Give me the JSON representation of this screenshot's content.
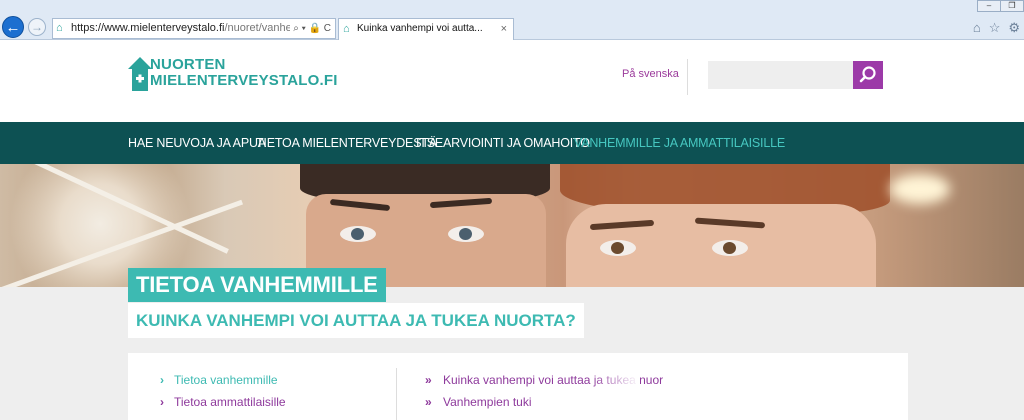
{
  "browser": {
    "url_main": "https://www.mielenterveystalo.fi",
    "url_path": "/nuoret/vanhemm",
    "tab_title": "Kuinka vanhempi voi autta...",
    "tab_close": "×",
    "back_symbol": "←",
    "forward_symbol": "→",
    "addr_tools": "⌕ ▾ 🔒 C"
  },
  "header": {
    "logo_line1": "NUORTEN",
    "logo_line2": "MIELENTERVEYSTALO.FI",
    "language_link": "På svenska",
    "search": {
      "value": "",
      "placeholder": ""
    }
  },
  "nav": {
    "items": [
      {
        "label": "HAE NEUVOJA JA APUA",
        "active": false
      },
      {
        "label": "TIETOA MIELENTERVEYDESTÄ",
        "active": false
      },
      {
        "label": "ITSEARVIOINTI JA OMAHOITO",
        "active": false
      },
      {
        "label": "VANHEMMILLE JA AMMATTILAISILLE",
        "active": true
      }
    ]
  },
  "page": {
    "title": "TIETOA VANHEMMILLE",
    "subtitle": "KUINKA VANHEMPI VOI AUTTAA JA TUKEA NUORTA?"
  },
  "left_menu": [
    {
      "chevron": "›",
      "label": "Tietoa vanhemmille",
      "color": "#3dbab2"
    },
    {
      "chevron": "›",
      "label": "Tietoa ammattilaisille",
      "color": "#8e3a9c"
    }
  ],
  "right_menu": [
    {
      "chevron": "»",
      "label": "Kuinka vanhempi voi auttaa ja tukea nuor"
    },
    {
      "chevron": "»",
      "label": "Vanhempien tuki"
    }
  ],
  "colors": {
    "teal": "#3dbab2",
    "dark_teal_nav": "#0d5153",
    "purple": "#9c3aa8",
    "light_grey_bg": "#eeeeee"
  },
  "icons": [
    "back-icon",
    "forward-icon",
    "search-icon",
    "lock-icon",
    "refresh-icon",
    "home-icon",
    "star-icon",
    "gear-icon",
    "logo-house-icon"
  ]
}
